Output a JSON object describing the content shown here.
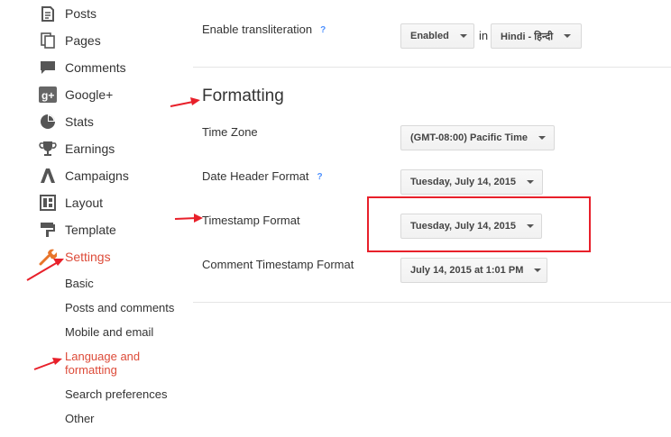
{
  "sidebar": {
    "items": [
      {
        "label": "Posts",
        "icon": "posts-icon"
      },
      {
        "label": "Pages",
        "icon": "pages-icon"
      },
      {
        "label": "Comments",
        "icon": "comments-icon"
      },
      {
        "label": "Google+",
        "icon": "google-plus-icon"
      },
      {
        "label": "Stats",
        "icon": "stats-icon"
      },
      {
        "label": "Earnings",
        "icon": "earnings-icon"
      },
      {
        "label": "Campaigns",
        "icon": "campaigns-icon"
      },
      {
        "label": "Layout",
        "icon": "layout-icon"
      },
      {
        "label": "Template",
        "icon": "template-icon"
      },
      {
        "label": "Settings",
        "icon": "settings-icon"
      }
    ],
    "settings_sub": [
      {
        "label": "Basic"
      },
      {
        "label": "Posts and comments"
      },
      {
        "label": "Mobile and email"
      },
      {
        "label": "Language and formatting"
      },
      {
        "label": "Search preferences"
      },
      {
        "label": "Other"
      }
    ]
  },
  "language": {
    "transliteration_label": "Enable transliteration",
    "help": "?",
    "enabled_value": "Enabled",
    "in_text": "in",
    "language_value": "Hindi - हिन्दी"
  },
  "formatting": {
    "title": "Formatting",
    "time_zone_label": "Time Zone",
    "time_zone_value": "(GMT-08:00) Pacific Time",
    "date_header_label": "Date Header Format",
    "date_header_value": "Tuesday, July 14, 2015",
    "timestamp_label": "Timestamp Format",
    "timestamp_value": "Tuesday, July 14, 2015",
    "comment_timestamp_label": "Comment Timestamp Format",
    "comment_timestamp_value": "July 14, 2015 at 1:01 PM"
  },
  "colors": {
    "active": "#dd4b39",
    "annotation": "#e8202a",
    "help": "#4d90fe"
  }
}
